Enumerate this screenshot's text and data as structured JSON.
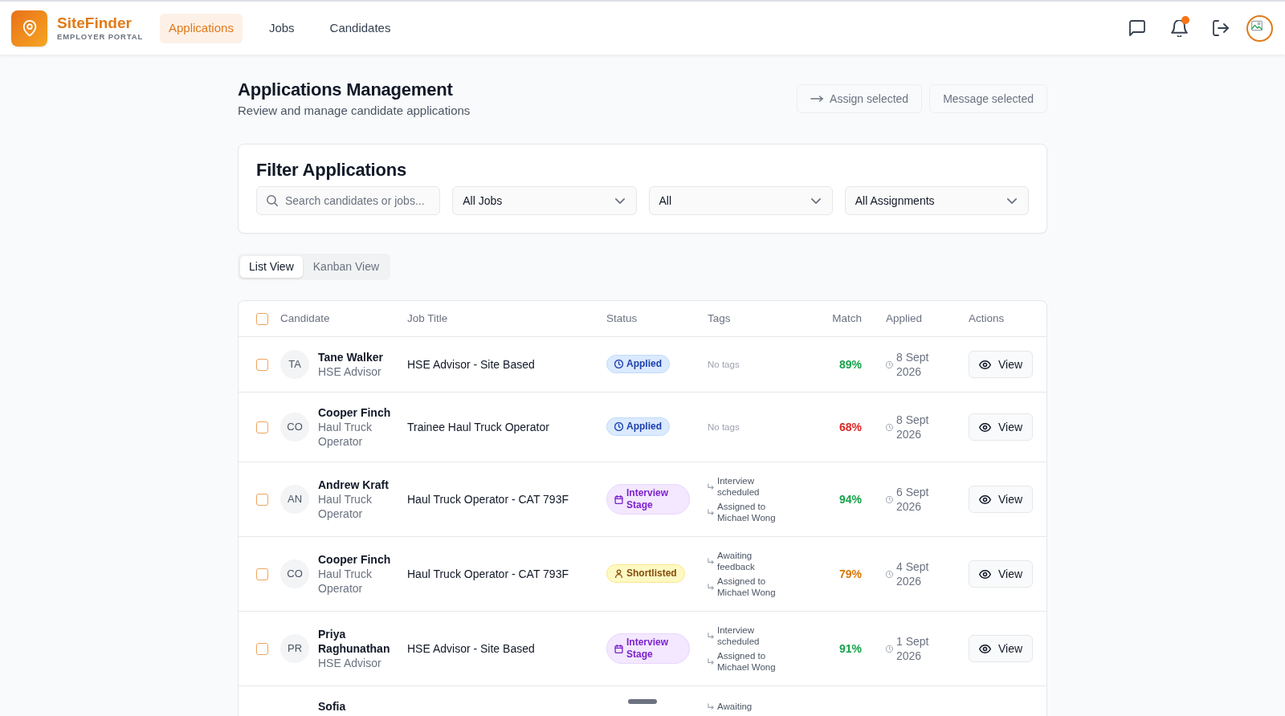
{
  "header": {
    "brand": {
      "name": "SiteFinder",
      "tagline": "EMPLOYER PORTAL"
    },
    "nav": [
      {
        "label": "Applications",
        "selected": true
      },
      {
        "label": "Jobs",
        "selected": false
      },
      {
        "label": "Candidates",
        "selected": false
      }
    ],
    "notifications": {
      "unread": true
    }
  },
  "page": {
    "title": "Applications Management",
    "subtitle": "Review and manage candidate applications",
    "actions": [
      {
        "kind": "assign",
        "label": "Assign selected",
        "disabled": true
      },
      {
        "kind": "message",
        "label": "Message selected",
        "disabled": true
      }
    ]
  },
  "filters": {
    "title": "Filter Applications",
    "search": {
      "placeholder": "Search candidates or jobs..."
    },
    "selects": [
      {
        "value": "All Jobs"
      },
      {
        "value": "All"
      },
      {
        "value": "All Assignments"
      }
    ]
  },
  "view_tabs": [
    {
      "label": "List View",
      "selected": true
    },
    {
      "label": "Kanban View",
      "selected": false
    }
  ],
  "table": {
    "select_all": {
      "checked": false
    },
    "columns": [
      "Candidate",
      "Job Title",
      "Status",
      "Tags",
      "Match",
      "Applied",
      "Actions"
    ],
    "rows": [
      {
        "selected": false,
        "initials": "TA",
        "name": "Tane Walker",
        "role": "HSE Advisor",
        "job_title": "HSE Advisor - Site Based",
        "status": {
          "kind": "applied",
          "label": "Applied"
        },
        "tags_note": "No tags",
        "match": {
          "value": "89%",
          "color": "#16a34a"
        },
        "applied": "8 Sept 2026",
        "action": "View"
      },
      {
        "selected": false,
        "initials": "CO",
        "name": "Cooper Finch",
        "role": "Haul Truck Operator",
        "job_title": "Trainee Haul Truck Operator",
        "status": {
          "kind": "applied",
          "label": "Applied"
        },
        "tags_note": "No tags",
        "match": {
          "value": "68%",
          "color": "#dc2626"
        },
        "applied": "8 Sept 2026",
        "action": "View"
      },
      {
        "selected": false,
        "initials": "AN",
        "name": "Andrew Kraft",
        "role": "Haul Truck Operator",
        "job_title": "Haul Truck Operator - CAT 793F",
        "status": {
          "kind": "interview",
          "label": "Interview Stage"
        },
        "tags": [
          "Interview scheduled",
          "Assigned to Michael Wong"
        ],
        "match": {
          "value": "94%",
          "color": "#16a34a"
        },
        "applied": "6 Sept 2026",
        "action": "View"
      },
      {
        "selected": false,
        "initials": "CO",
        "name": "Cooper Finch",
        "role": "Haul Truck Operator",
        "job_title": "Haul Truck Operator - CAT 793F",
        "status": {
          "kind": "shortlisted",
          "label": "Shortlisted"
        },
        "tags": [
          "Awaiting feedback",
          "Assigned to Michael Wong"
        ],
        "match": {
          "value": "79%",
          "color": "#d97706"
        },
        "applied": "4 Sept 2026",
        "action": "View"
      },
      {
        "selected": false,
        "initials": "PR",
        "name": "Priya Raghunathan",
        "role": "HSE Advisor",
        "job_title": "HSE Advisor - Site Based",
        "status": {
          "kind": "interview",
          "label": "Interview Stage"
        },
        "tags": [
          "Interview scheduled",
          "Assigned to Michael Wong"
        ],
        "match": {
          "value": "91%",
          "color": "#16a34a"
        },
        "applied": "1 Sept 2026",
        "action": "View"
      },
      {
        "name": "Sofia",
        "tags": [
          "Awaiting"
        ]
      }
    ]
  }
}
